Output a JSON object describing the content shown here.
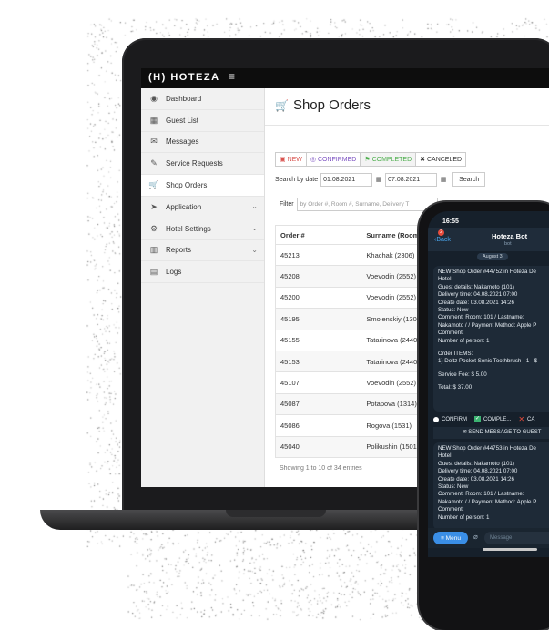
{
  "colors": {
    "accent_green": "#4cae4c",
    "danger": "#d9534f",
    "confirm": "#7a4fc0",
    "telegram_blue": "#3a8ee6"
  },
  "app": {
    "logo": "(H) HOTEZA",
    "menu_icon": "hamburger-icon"
  },
  "sidebar": {
    "items": [
      {
        "label": "Dashboard",
        "icon": "dashboard-icon",
        "glyph": "◉",
        "active": false,
        "chevron": false
      },
      {
        "label": "Guest List",
        "icon": "users-icon",
        "glyph": "▦",
        "active": false,
        "chevron": false
      },
      {
        "label": "Messages",
        "icon": "chat-icon",
        "glyph": "✉",
        "active": false,
        "chevron": false
      },
      {
        "label": "Service Requests",
        "icon": "wrench-icon",
        "glyph": "✎",
        "active": false,
        "chevron": false
      },
      {
        "label": "Shop Orders",
        "icon": "cart-icon",
        "glyph": "🛒",
        "active": true,
        "chevron": false
      },
      {
        "label": "Application",
        "icon": "rocket-icon",
        "glyph": "➤",
        "active": false,
        "chevron": true
      },
      {
        "label": "Hotel Settings",
        "icon": "gears-icon",
        "glyph": "⚙",
        "active": false,
        "chevron": true
      },
      {
        "label": "Reports",
        "icon": "chart-icon",
        "glyph": "▥",
        "active": false,
        "chevron": true
      },
      {
        "label": "Logs",
        "icon": "list-icon",
        "glyph": "▤",
        "active": false,
        "chevron": false
      }
    ]
  },
  "main": {
    "title": "Shop Orders",
    "status_filters": {
      "new": "NEW",
      "confirmed": "CONFIRMED",
      "completed": "COMPLETED",
      "canceled": "CANCELED"
    },
    "date_label": "Search by date",
    "date_from": "01.08.2021",
    "date_to": "07.08.2021",
    "search_label": "Search",
    "filter_label": "Filter",
    "filter_placeholder": "by Order #, Room #, Surname, Delivery T",
    "table": {
      "headers": [
        "Order #",
        "Surname (Room #)"
      ],
      "rows": [
        [
          "45213",
          "Khachak (2306)"
        ],
        [
          "45208",
          "Voevodin (2552)"
        ],
        [
          "45200",
          "Voevodin (2552)"
        ],
        [
          "45195",
          "Smolenskiy (1308)"
        ],
        [
          "45155",
          "Tatarinova (2440)"
        ],
        [
          "45153",
          "Tatarinova (2440)"
        ],
        [
          "45107",
          "Voevodin (2552)"
        ],
        [
          "45087",
          "Potapova (1314)"
        ],
        [
          "45086",
          "Rogova (1531)"
        ],
        [
          "45040",
          "Polikushin (1501)"
        ]
      ]
    },
    "showing": "Showing 1 to 10 of 34 entries"
  },
  "phone": {
    "time": "16:55",
    "back": "Back",
    "badge": "2",
    "bot_name": "Hoteza Bot",
    "bot_sub": "bot",
    "date_chip": "August 3",
    "message1": {
      "line1": "NEW Shop Order #44752 in Hoteza De",
      "line2": "Hotel",
      "guest": "Guest details: Nakamoto (101)",
      "delivery": "Delivery time: 04.08.2021 07:00",
      "create": "Create date: 03.08.2021 14:26",
      "status": "Status: New",
      "comment1": "Comment:  Room: 101 / Lastname:",
      "comment2": "Nakamoto / / Payment Method: Apple P",
      "comment3": "Comment:",
      "persons": "Number of person: 1",
      "items_title": "Order ITEMS:",
      "item": "1) Doltz Pocket Sonic Toothbrush - 1 - $",
      "fee": "Service Fee: $ 5.00",
      "total": "Total: $ 37.00"
    },
    "actions": {
      "confirm": "CONFIRM",
      "complete": "COMPLE...",
      "cancel": "CA"
    },
    "send": "SEND MESSAGE TO GUEST",
    "message2": {
      "line1": "NEW Shop Order #44753 in Hoteza De",
      "line2": "Hotel",
      "guest": "Guest details: Nakamoto (101)",
      "delivery": "Delivery time: 04.08.2021 07:00",
      "create": "Create date: 03.08.2021 14:26",
      "status": "Status: New",
      "comment1": "Comment:  Room: 101 / Lastname:",
      "comment2": "Nakamoto / / Payment Method: Apple P",
      "comment3": "Comment:",
      "persons": "Number of person: 1"
    },
    "menu": "Menu",
    "message_placeholder": "Message"
  }
}
